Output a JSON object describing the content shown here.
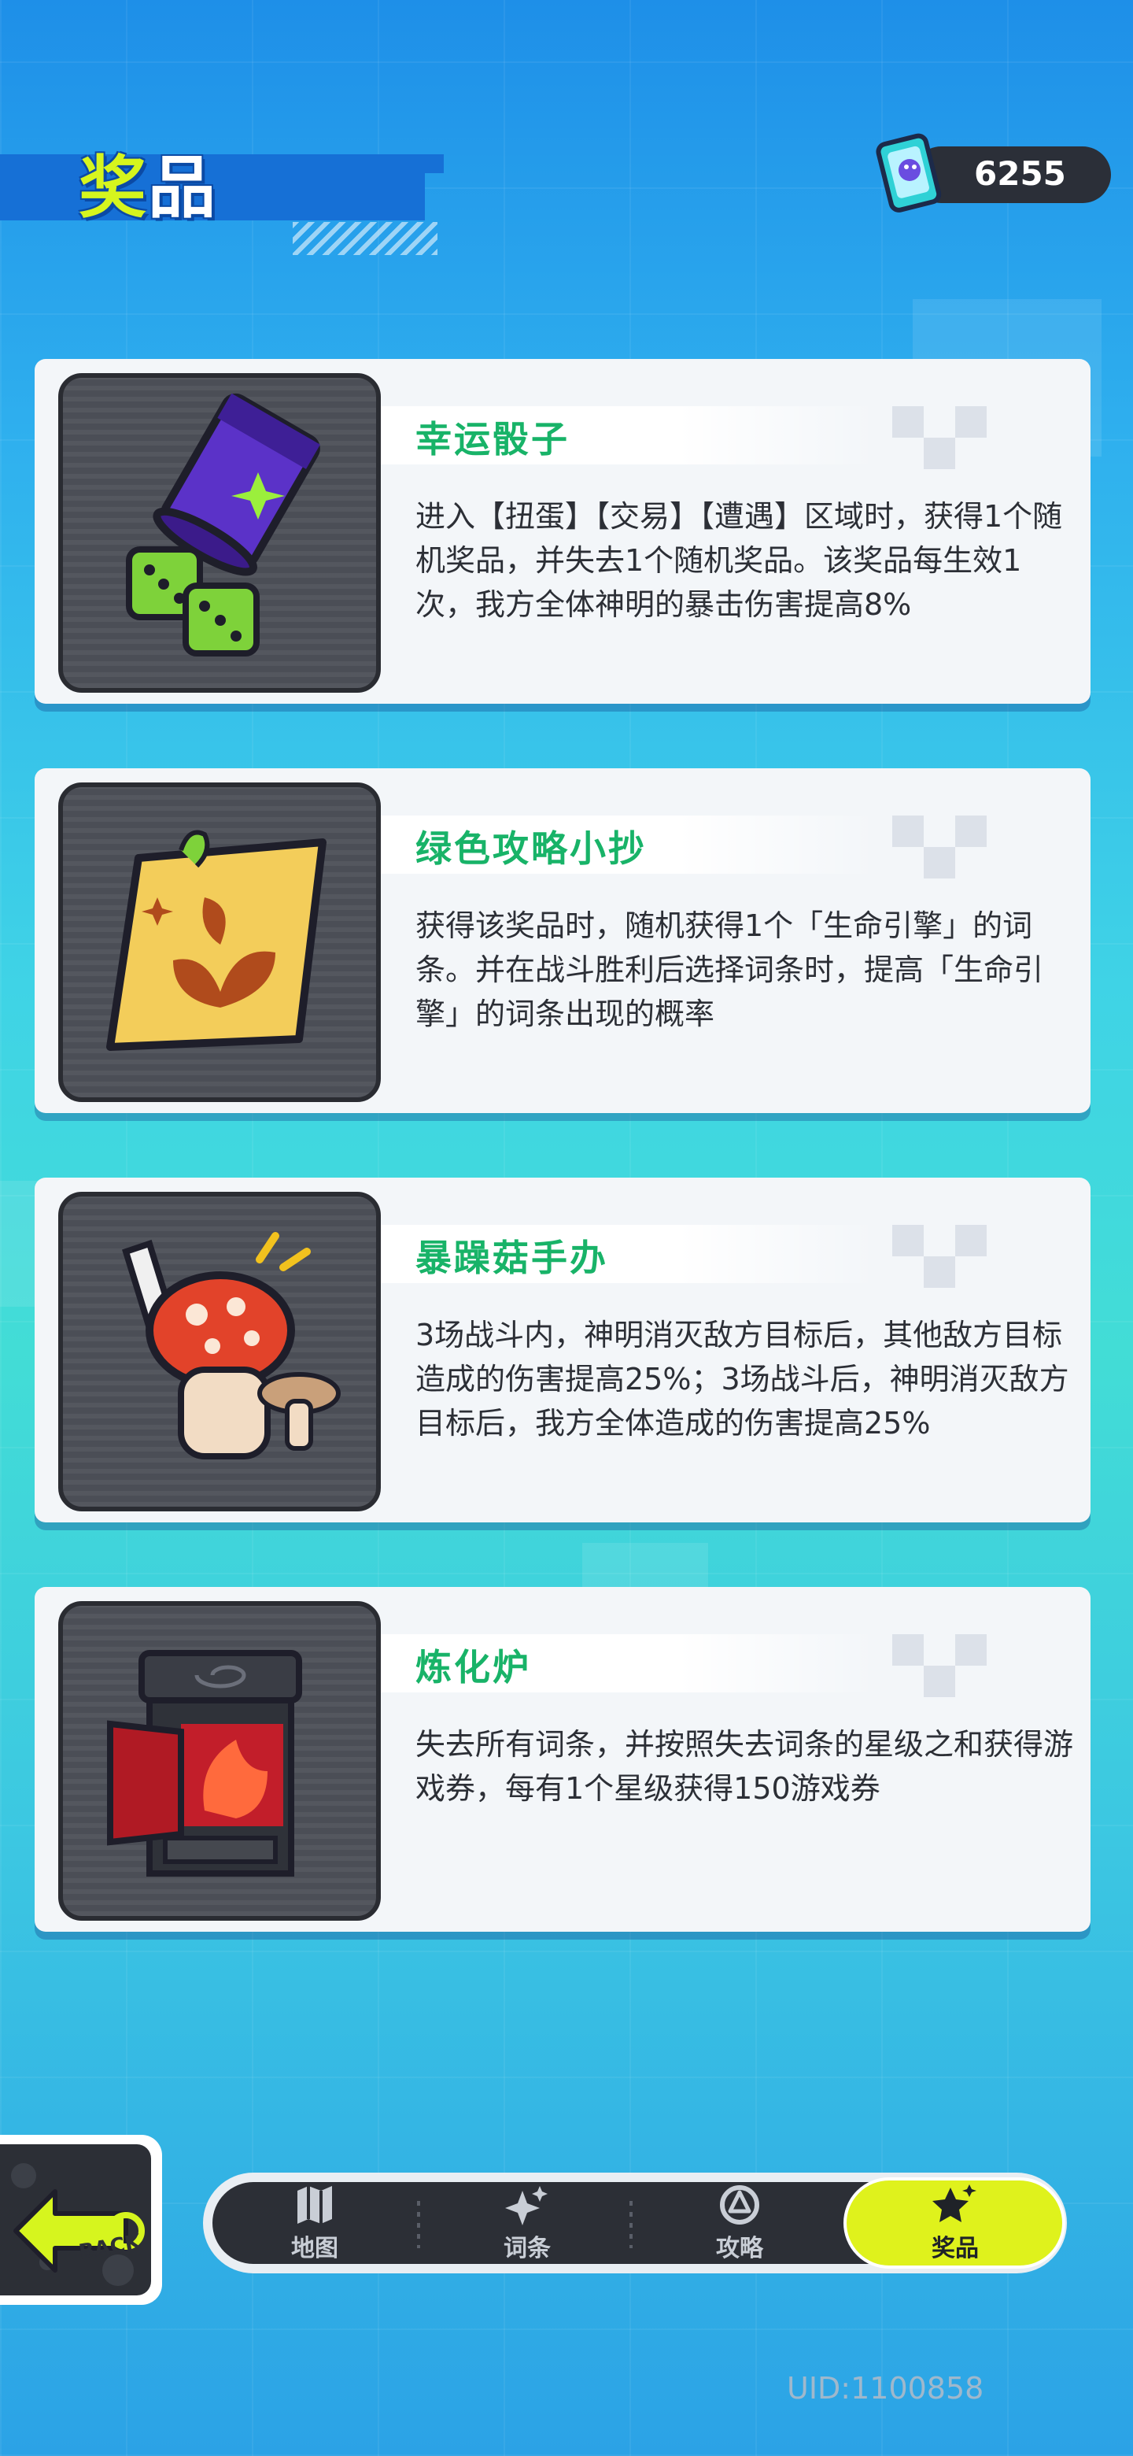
{
  "header": {
    "title_first_char": "奖",
    "title_rest": "品",
    "currency_value": "6255",
    "currency_icon": "ticket-icon"
  },
  "rewards": [
    {
      "title": "幸运骰子",
      "description": "进入【扭蛋】【交易】【遭遇】区域时，获得1个随机奖品，并失去1个随机奖品。该奖品每生效1次，我方全体神明的暴击伤害提高8%",
      "icon": "dice-cup-icon"
    },
    {
      "title": "绿色攻略小抄",
      "description": "获得该奖品时，随机获得1个「生命引擎」的词条。并在战斗胜利后选择词条时，提高「生命引擎」的词条出现的概率",
      "icon": "sticky-note-icon"
    },
    {
      "title": "暴躁菇手办",
      "description": "3场战斗内，神明消灭敌方目标后，其他敌方目标造成的伤害提高25%；3场战斗后，神明消灭敌方目标后，我方全体造成的伤害提高25%",
      "icon": "mushroom-figure-icon"
    },
    {
      "title": "炼化炉",
      "description": "失去所有词条，并按照失去词条的星级之和获得游戏券，每有1个星级获得150游戏券",
      "icon": "furnace-icon"
    }
  ],
  "nav": {
    "back_label": "BACK",
    "items": [
      {
        "label": "地图",
        "icon": "map-icon"
      },
      {
        "label": "词条",
        "icon": "sparkle-icon"
      },
      {
        "label": "攻略",
        "icon": "strategy-icon"
      },
      {
        "label": "奖品",
        "icon": "reward-star-icon",
        "active": true
      }
    ]
  },
  "footer": {
    "uid": "UID:1100858"
  },
  "colors": {
    "accent": "#dff21c",
    "title_green": "#18b368",
    "header_blue": "#1670d6"
  }
}
